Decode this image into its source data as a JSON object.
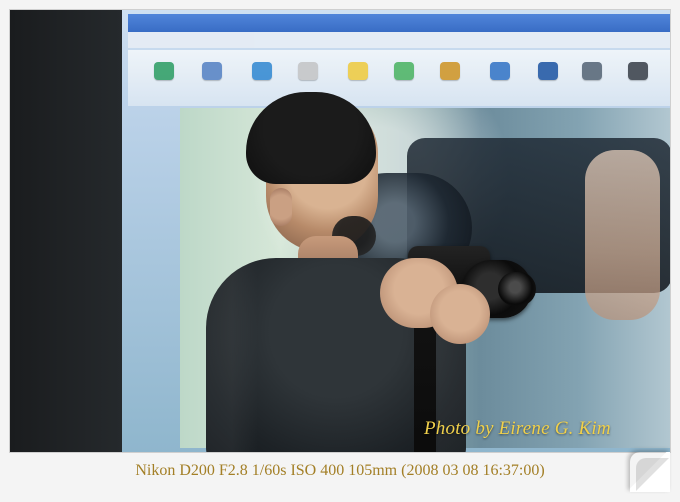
{
  "overlay": {
    "photo_credit": "Photo by Eirene G. Kim",
    "exif_caption": "Nikon D200 F2.8 1/60s ISO 400   105mm  (2008 03 08 16:37:00)"
  }
}
